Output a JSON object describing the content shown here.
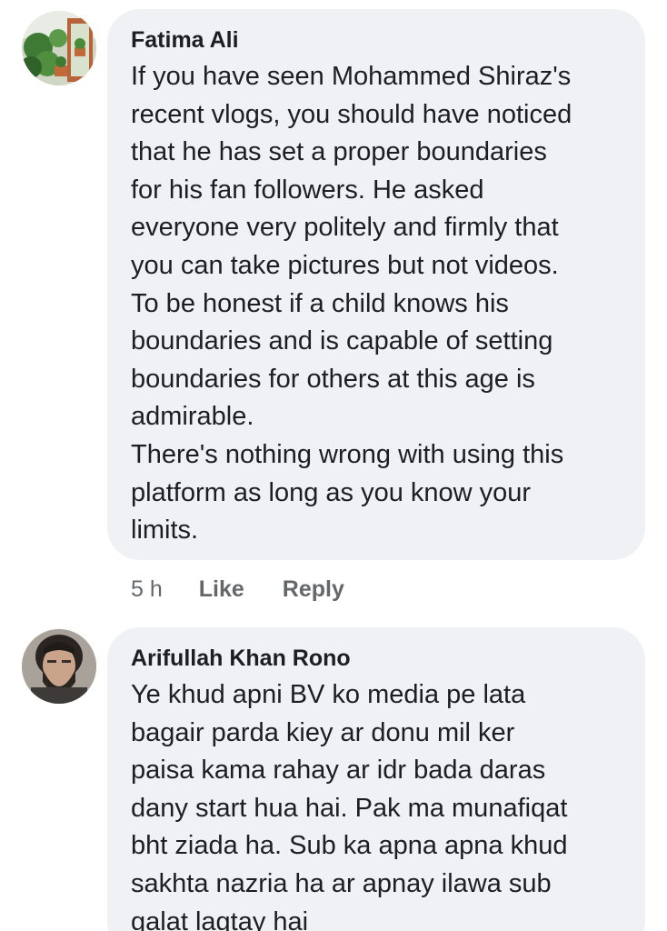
{
  "comments": [
    {
      "author": "Fatima Ali",
      "lines": [
        "If you have seen Mohammed Shiraz's",
        "recent vlogs, you should have noticed",
        "that he has set a proper boundaries",
        "for his fan followers. He asked",
        "everyone very politely and firmly that",
        "you can take pictures but not videos.",
        "To be honest if a child knows his",
        "boundaries and is capable of setting",
        "boundaries for others at this age is",
        "admirable.",
        "There's nothing wrong with using this",
        "platform as long as you know your",
        "limits."
      ],
      "time": "5 h",
      "like_label": "Like",
      "reply_label": "Reply"
    },
    {
      "author": "Arifullah Khan Rono",
      "lines": [
        "Ye khud apni BV ko media pe lata",
        "bagair parda kiey ar donu mil ker",
        "paisa kama rahay ar idr bada daras",
        "dany start hua hai. Pak ma munafiqat",
        "bht ziada ha. Sub ka apna apna khud",
        "sakhta nazria ha ar apnay ilawa sub",
        "galat lagtay hai"
      ]
    }
  ],
  "colors": {
    "bubble": "#eff1f4",
    "text": "#1c1e21",
    "meta": "#65676b"
  }
}
